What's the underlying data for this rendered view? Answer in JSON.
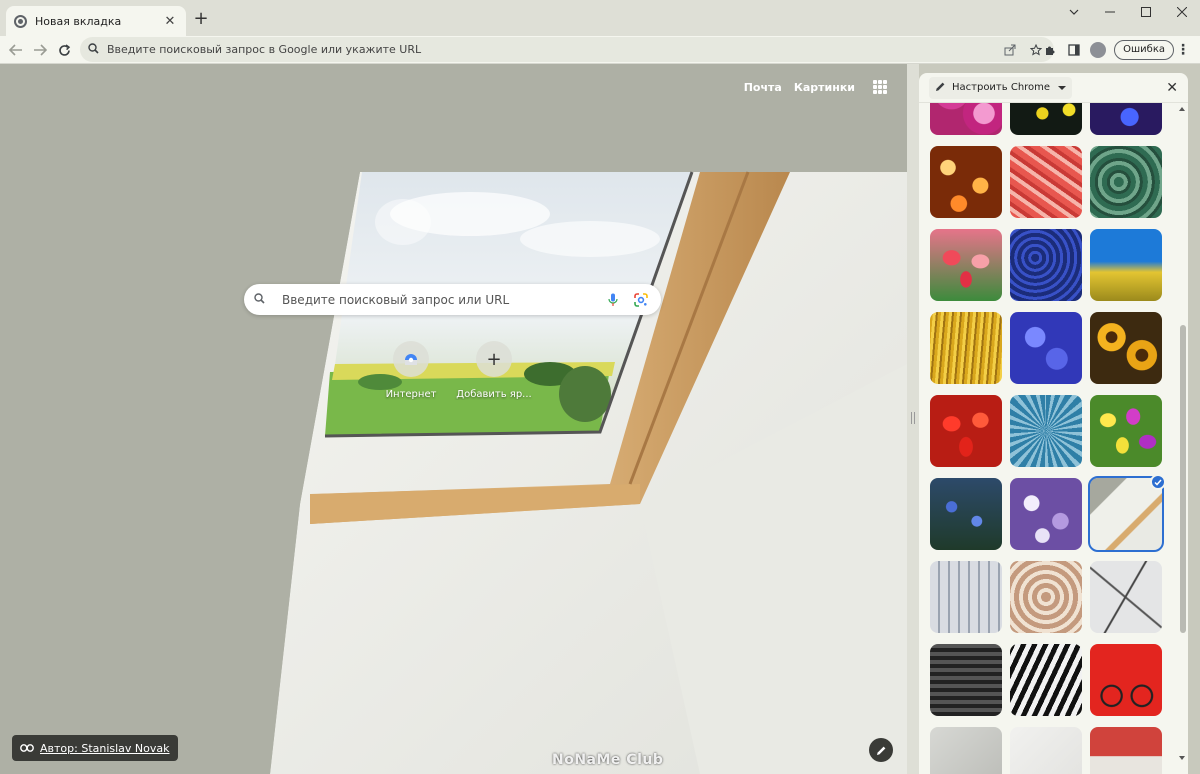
{
  "browser": {
    "tab_title": "Новая вкладка",
    "omnibox_placeholder": "Введите поисковый запрос в Google или укажите URL",
    "profile_error_label": "Ошибка"
  },
  "ntp": {
    "link_mail": "Почта",
    "link_images": "Картинки",
    "search_placeholder": "Введите поисковый запрос или URL",
    "shortcuts": [
      {
        "label": "Интернет"
      },
      {
        "label": "Добавить яр..."
      }
    ],
    "attribution": "Автор: Stanislav Novak",
    "watermark": "NoNaMe Club"
  },
  "side_panel": {
    "title": "Настроить Chrome",
    "selected_index": 17,
    "thumbnails": [
      {
        "name": "pink-dahlia"
      },
      {
        "name": "yellow-flowers-dark"
      },
      {
        "name": "blue-purple-bokeh"
      },
      {
        "name": "orange-bokeh"
      },
      {
        "name": "red-feathers"
      },
      {
        "name": "green-swirl"
      },
      {
        "name": "tulips"
      },
      {
        "name": "blue-roses"
      },
      {
        "name": "yellow-grass-blue-sky"
      },
      {
        "name": "yellow-reeds"
      },
      {
        "name": "blue-irises"
      },
      {
        "name": "sunflowers"
      },
      {
        "name": "red-tulip-field"
      },
      {
        "name": "blue-succulent"
      },
      {
        "name": "colorful-tulips"
      },
      {
        "name": "blue-wildflowers"
      },
      {
        "name": "purple-white-flowers"
      },
      {
        "name": "skylight-window"
      },
      {
        "name": "white-building"
      },
      {
        "name": "spiral-stairs"
      },
      {
        "name": "cracked-glass"
      },
      {
        "name": "dark-grid-tiles"
      },
      {
        "name": "zebra-stripes"
      },
      {
        "name": "red-bicycle"
      },
      {
        "name": "grey-abstract"
      },
      {
        "name": "white-abstract"
      },
      {
        "name": "red-buildings"
      }
    ]
  }
}
